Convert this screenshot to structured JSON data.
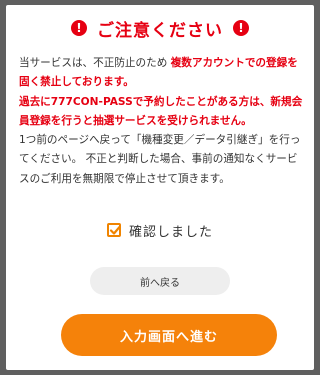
{
  "modal": {
    "title": "ご注意ください",
    "warn_icon_glyph": "!",
    "body": {
      "p1_normal": "当サービスは、不正防止のため ",
      "p1_red": "複数アカウントでの登録を固く禁止しております。",
      "p2_red": "過去に777CON-PASSで予約したことがある方は、新規会員登録を行うと抽選サービスを受けられません。",
      "p3_normal": "1つ前のページへ戻って「機種変更／データ引継ぎ」を行ってください。 不正と判断した場合、事前の通知なくサービスのご利用を無期限で停止させて頂きます。"
    },
    "confirm_label": "確認しました",
    "confirm_checked": true,
    "back_button_label": "前へ戻る",
    "next_button_label": "入力画面へ進む"
  },
  "colors": {
    "accent_red": "#e60012",
    "accent_orange": "#f5820a",
    "overlay": "#5f5f5f"
  },
  "icons": {
    "warning": "exclamation-circle-icon",
    "checkbox": "checkmark-icon"
  }
}
